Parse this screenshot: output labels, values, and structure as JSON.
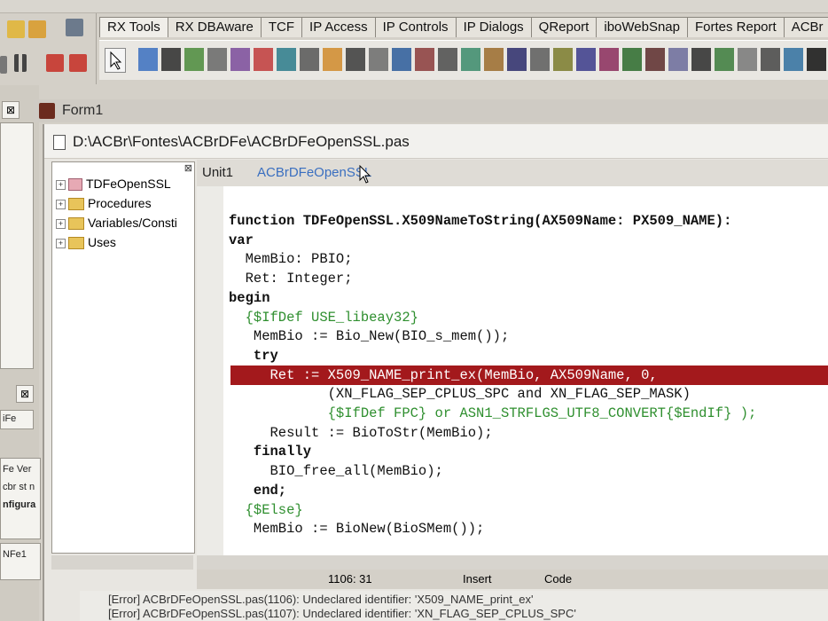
{
  "palette": {
    "tabs": [
      "RX Tools",
      "RX DBAware",
      "TCF",
      "IP Access",
      "IP Controls",
      "IP Dialogs",
      "QReport",
      "iboWebSnap",
      "Fortes Report",
      "ACBr"
    ]
  },
  "form": {
    "title": "Form1"
  },
  "editor": {
    "file_path": "D:\\ACBr\\Fontes\\ACBrDFe\\ACBrDFeOpenSSL.pas",
    "tabs": [
      "Unit1",
      "ACBrDFeOpenSSL"
    ]
  },
  "explorer": {
    "items": [
      "TDFeOpenSSL",
      "Procedures",
      "Variables/Consti",
      "Uses"
    ]
  },
  "code": {
    "lines": [
      "function TDFeOpenSSL.X509NameToString(AX509Name: PX509_NAME):",
      "var",
      "  MemBio: PBIO;",
      "  Ret: Integer;",
      "begin",
      "  {$IfDef USE_libeay32}",
      "   MemBio := Bio_New(BIO_s_mem());",
      "   try",
      "     Ret := X509_NAME_print_ex(MemBio, AX509Name, 0,",
      "            (XN_FLAG_SEP_CPLUS_SPC and XN_FLAG_SEP_MASK)",
      "            {$IfDef FPC} or ASN1_STRFLGS_UTF8_CONVERT{$EndIf} );",
      "     Result := BioToStr(MemBio);",
      "   finally",
      "     BIO_free_all(MemBio);",
      "   end;",
      "  {$Else}",
      "   MemBio := BioNew(BioSMem());"
    ]
  },
  "status": {
    "position": "1106: 31",
    "mode": "Insert",
    "view": "Code"
  },
  "messages": [
    "[Error] ACBrDFeOpenSSL.pas(1106): Undeclared identifier: 'X509_NAME_print_ex'",
    "[Error] ACBrDFeOpenSSL.pas(1107): Undeclared identifier: 'XN_FLAG_SEP_CPLUS_SPC'"
  ],
  "left_panel": {
    "labels": [
      "iFe",
      "Fe Ver",
      "cbr st n",
      "nfigura",
      "NFe1"
    ]
  }
}
